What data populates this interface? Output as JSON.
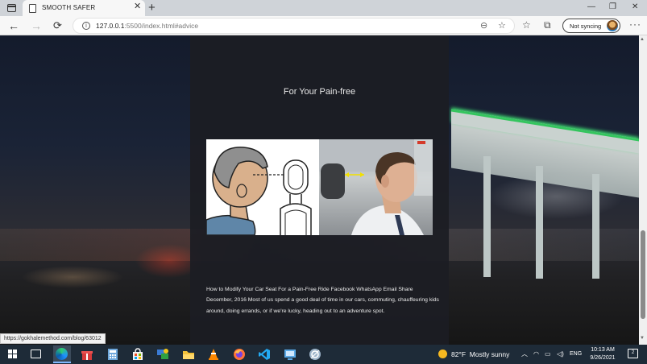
{
  "browser": {
    "tab_title": "SMOOTH SAFER",
    "url_host": "127.0.0.1",
    "url_rest": ":5500/index.html#advice",
    "sync_label": "Not syncing",
    "window_minimize": "—",
    "window_restore": "❐",
    "window_close": "✕",
    "new_tab": "+",
    "tab_close": "✕",
    "back": "←",
    "forward": "→",
    "refresh": "⟳",
    "info": "i",
    "menu": "···"
  },
  "page": {
    "section_title": "For Your Pain-free",
    "image_alt": "headrest posture illustration and driver photo",
    "body_text": "How to Modify Your Car Seat For a Pain-Free Ride Facebook WhatsApp Email Share December, 2016 Most of us spend a good deal of time in our cars, commuting, chauffeuring kids around, doing errands, or if we're lucky, heading out to an adventure spot."
  },
  "status_bar": {
    "hover_url": "https://gokhalemethod.com/blog/63012"
  },
  "taskbar": {
    "weather_temp": "82°F",
    "weather_desc": "Mostly sunny",
    "language": "ENG",
    "time": "10:13 AM",
    "date": "9/26/2021",
    "notification_count": "2",
    "icons": [
      "windows-start-icon",
      "task-view-icon",
      "edge-icon",
      "gift-icon",
      "calculator-icon",
      "store-icon",
      "network-app-icon",
      "file-explorer-icon",
      "vlc-icon",
      "firefox-icon",
      "vscode-icon",
      "remote-desktop-icon",
      "snipping-tool-icon"
    ]
  },
  "colors": {
    "page_panel": "#1c1d24",
    "accent_green": "#34c55e",
    "taskbar": "#1e2b38"
  }
}
